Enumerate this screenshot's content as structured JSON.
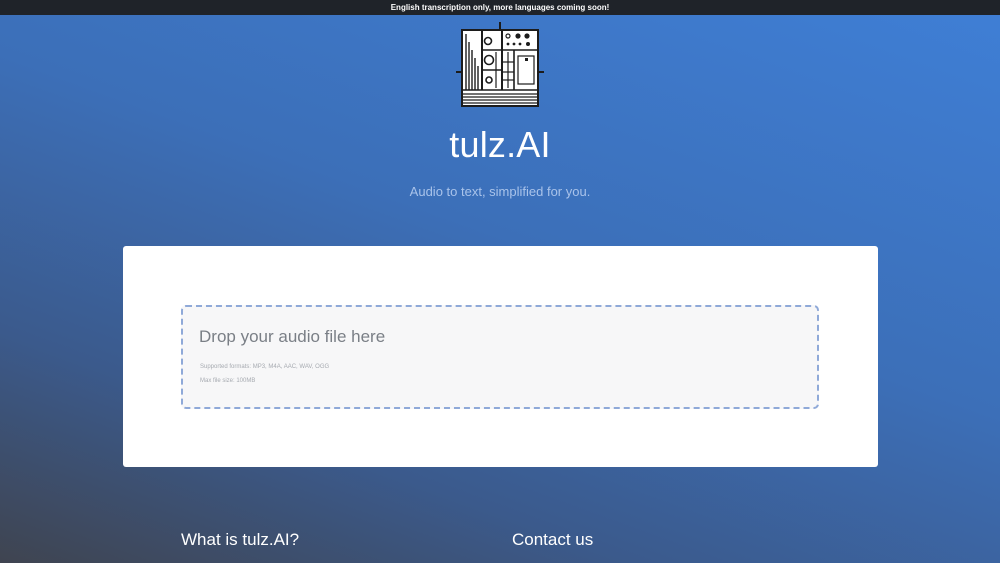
{
  "banner": {
    "text": "English transcription only, more languages coming soon!"
  },
  "header": {
    "logo_icon": "modular-synth-logo-icon",
    "title": "tulz.AI",
    "tagline": "Audio to text, simplified for you."
  },
  "upload": {
    "drop_label": "Drop your audio file here",
    "supported_formats": "Supported formats: MP3, M4A, AAC, WAV, OGG",
    "max_size": "Max file size: 100MB"
  },
  "footer": {
    "what_heading": "What is tulz.AI?",
    "contact_heading": "Contact us"
  },
  "colors": {
    "banner_bg": "#1f2329",
    "dropzone_border": "#8fa9d8",
    "background_top": "#3f7fd6",
    "background_bottom": "#3f4450"
  }
}
